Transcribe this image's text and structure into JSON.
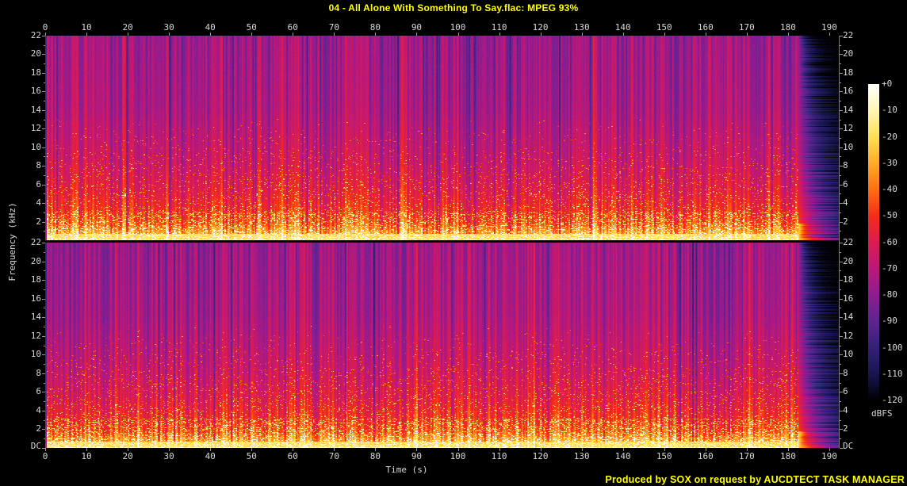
{
  "window": {
    "title": "04 - All Alone With Something To Say.flac: MPEG 93%"
  },
  "credit": "Produced by SOX on request by AUCDTECT TASK MANAGER",
  "colors": {
    "background": "#000000",
    "title_text": "#ffff00",
    "credit_text": "#ffff00",
    "axis_text": "#d8d8d8",
    "tick": "#9a9a9a",
    "axis_line": "#7d7d7d"
  },
  "chart_data": {
    "type": "heatmap",
    "subtype": "stereo-audio-spectrogram",
    "title": "04 - All Alone With Something To Say.flac: MPEG 93%",
    "source_note": "Produced by SOX on request by AUCDTECT TASK MANAGER",
    "channels": 2,
    "channel_names": [
      "channel-1",
      "channel-2"
    ],
    "x_axis": {
      "label": "Time (s)",
      "range_s": [
        0,
        192.5
      ],
      "ticks": [
        "0",
        "10",
        "20",
        "30",
        "40",
        "50",
        "60",
        "70",
        "80",
        "90",
        "100",
        "110",
        "120",
        "130",
        "140",
        "150",
        "160",
        "170",
        "180",
        "190"
      ]
    },
    "y_axis": {
      "label": "Frequency (kHz)",
      "range_khz": [
        0,
        22
      ],
      "ticks": [
        "22",
        "20",
        "18",
        "16",
        "14",
        "12",
        "10",
        "8",
        "6",
        "4",
        "2"
      ],
      "dc_label": "DC"
    },
    "z_axis": {
      "label": "dBFS",
      "range_db": [
        -120,
        0
      ],
      "ticks": [
        "+0",
        "-10",
        "-20",
        "-30",
        "-40",
        "-50",
        "-60",
        "-70",
        "-80",
        "-90",
        "-100",
        "-110",
        "-120"
      ]
    },
    "observations": {
      "audio_ends_at_s": 183,
      "content": "Full-bandwidth music energy up to 22 kHz in both channels; bright yellow band below ~2 kHz; orange speckled energy 2-6 kHz; dense vertical note-onset striping (purple/red alternation) across the whole track; after ~183 s the signal decays to silence (purple -> navy -> black) with low-frequency tail persisting longest.",
      "lossy_estimate_in_title": "MPEG 93%"
    },
    "render": {
      "seeds": [
        1337,
        7331
      ],
      "audio_end_ratio": 0.949,
      "attack_columns": 2,
      "stripe_strength": 0.26,
      "palette": [
        [
          0.0,
          [
            0,
            0,
            0
          ]
        ],
        [
          0.083,
          [
            23,
            22,
            80
          ]
        ],
        [
          0.167,
          [
            52,
            32,
            120
          ]
        ],
        [
          0.25,
          [
            94,
            36,
            144
          ]
        ],
        [
          0.333,
          [
            142,
            28,
            144
          ]
        ],
        [
          0.417,
          [
            188,
            24,
            120
          ]
        ],
        [
          0.5,
          [
            220,
            28,
            80
          ]
        ],
        [
          0.583,
          [
            245,
            44,
            24
          ]
        ],
        [
          0.667,
          [
            255,
            111,
            18
          ]
        ],
        [
          0.75,
          [
            255,
            171,
            40
          ]
        ],
        [
          0.833,
          [
            255,
            224,
            85
          ]
        ],
        [
          0.917,
          [
            255,
            247,
            180
          ]
        ],
        [
          1.0,
          [
            255,
            255,
            255
          ]
        ]
      ],
      "base_level": [
        [
          0.0,
          0.355
        ],
        [
          0.35,
          0.38
        ],
        [
          0.6,
          0.44
        ],
        [
          0.75,
          0.5
        ],
        [
          0.85,
          0.56
        ],
        [
          0.92,
          0.62
        ],
        [
          0.96,
          0.72
        ],
        [
          1.0,
          0.8
        ]
      ],
      "bottom_band_level": 0.79,
      "speckle_max_boost": 0.32
    }
  }
}
